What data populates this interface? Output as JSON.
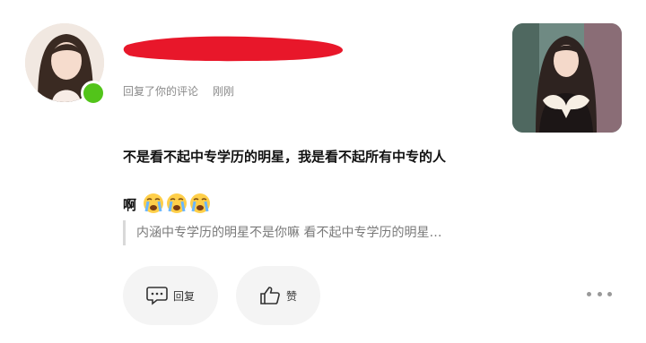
{
  "comment": {
    "meta_action": "回复了你的评论",
    "time": "刚刚",
    "line1": "不是看不起中专学历的明星，我是看不起所有中专的人",
    "line2": "啊",
    "emojis": [
      "crying-face-icon",
      "crying-face-icon",
      "crying-face-icon"
    ],
    "quote": "内涵中专学历的明星不是你嘛 看不起中专学历的明星…"
  },
  "actions": {
    "reply_label": "回复",
    "like_label": "赞"
  },
  "colors": {
    "online": "#52c41a",
    "redaction": "#e8172a",
    "button_bg": "#f4f4f4"
  }
}
